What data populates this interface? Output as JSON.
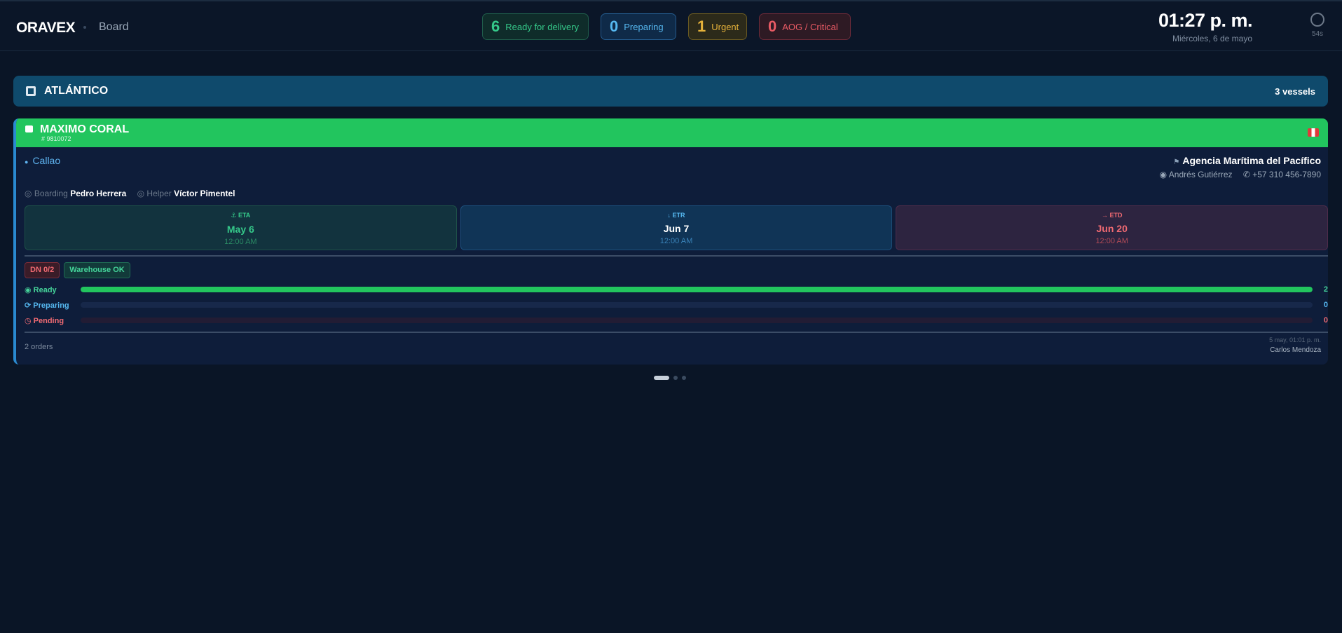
{
  "header": {
    "brand": "ORAVEX",
    "nav_label": "Board",
    "stats": [
      {
        "value": "6",
        "label": "Ready for delivery"
      },
      {
        "value": "0",
        "label": "Preparing"
      },
      {
        "value": "1",
        "label": "Urgent"
      },
      {
        "value": "0",
        "label": "AOG / Critical"
      }
    ],
    "clock": {
      "time": "01:27 p. m.",
      "date": "Miércoles, 6 de mayo"
    },
    "refresh": {
      "seconds": "54s",
      "icon": "refresh-ring-icon"
    }
  },
  "region": {
    "icon": "building-icon",
    "name": "ATLÁNTICO",
    "vessel_count": "3 vessels"
  },
  "vessel": {
    "name": "MAXIMO CORAL",
    "id": "# 9810072",
    "header_color": "#22c55e",
    "flag": "Peru",
    "port": "Callao",
    "agency": "Agencia Marítima del Pacífico",
    "agent_name": "Andrés Gutiérrez",
    "agent_phone": "+57 310 456-7890",
    "crew": {
      "boarding_label": "Boarding",
      "boarding_name": "Pedro Herrera",
      "helper_label": "Helper",
      "helper_name": "Víctor Pimentel"
    },
    "dates": [
      {
        "label": "ETA",
        "icon": "anchor-icon",
        "date": "May 6",
        "time": "12:00 AM"
      },
      {
        "label": "ETR",
        "icon": "arrow-down-icon",
        "date": "Jun 7",
        "time": "12:00 AM"
      },
      {
        "label": "ETD",
        "icon": "arrow-right-icon",
        "date": "Jun 20",
        "time": "12:00 AM"
      }
    ],
    "chips": {
      "dn": "DN 0/2",
      "warehouse": "Warehouse OK"
    },
    "progress": [
      {
        "label": "Ready",
        "icon": "check-circle-icon",
        "value": "2",
        "fraction": 1.0
      },
      {
        "label": "Preparing",
        "icon": "sync-icon",
        "value": "0",
        "fraction": 0.0
      },
      {
        "label": "Pending",
        "icon": "clock-icon",
        "value": "0",
        "fraction": 0.0
      }
    ],
    "orders": "2 orders",
    "updated_at": "5 may, 01:01 p. m.",
    "updated_by": "Carlos Mendoza"
  },
  "pager": {
    "pages": 3,
    "active": 1
  }
}
